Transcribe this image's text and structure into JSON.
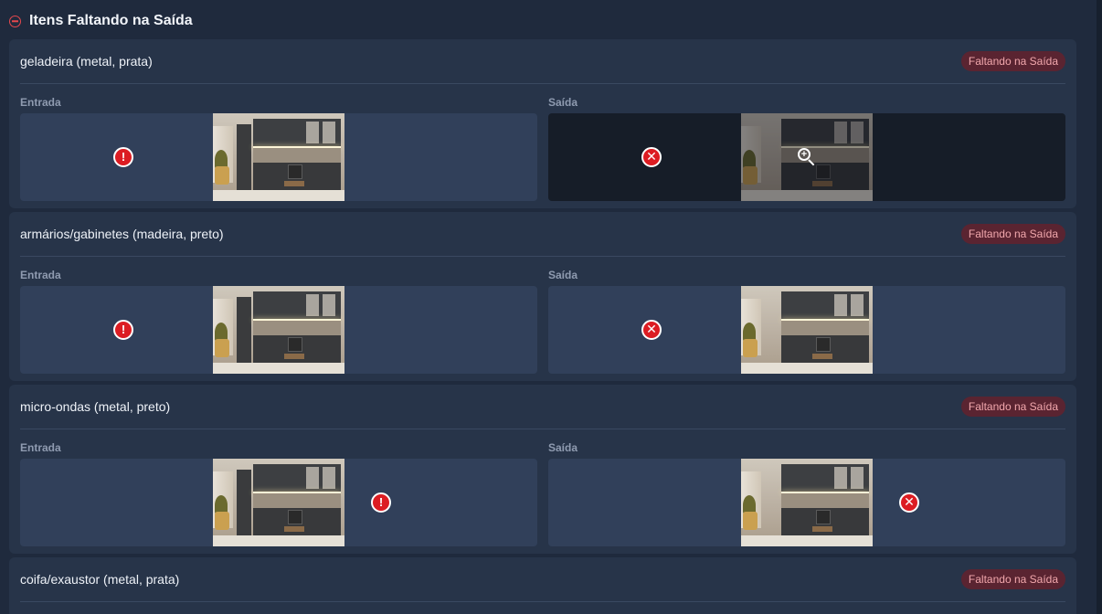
{
  "section": {
    "title": "Itens Faltando na Saída",
    "collapse_icon": "minus-circle-icon",
    "accent_color": "#e5484d"
  },
  "labels": {
    "entry": "Entrada",
    "exit": "Saída"
  },
  "items": [
    {
      "name": "geladeira (metal, prata)",
      "badge": "Faltando na Saída"
    },
    {
      "name": "armários/gabinetes (madeira, preto)",
      "badge": "Faltando na Saída"
    },
    {
      "name": "micro-ondas (metal, preto)",
      "badge": "Faltando na Saída"
    },
    {
      "name": "coifa/exaustor (metal, prata)",
      "badge": "Faltando na Saída"
    }
  ],
  "icons": {
    "entry_status": {
      "name": "alert-circle-icon",
      "glyph": "!"
    },
    "exit_status": {
      "name": "x-circle-icon",
      "glyph": "✕"
    },
    "zoom": {
      "name": "zoom-in-icon",
      "glyph": "+"
    }
  },
  "colors": {
    "badge_bg": "#5a2431",
    "badge_text": "#f2a8ad",
    "status_red": "#dc1c22"
  }
}
